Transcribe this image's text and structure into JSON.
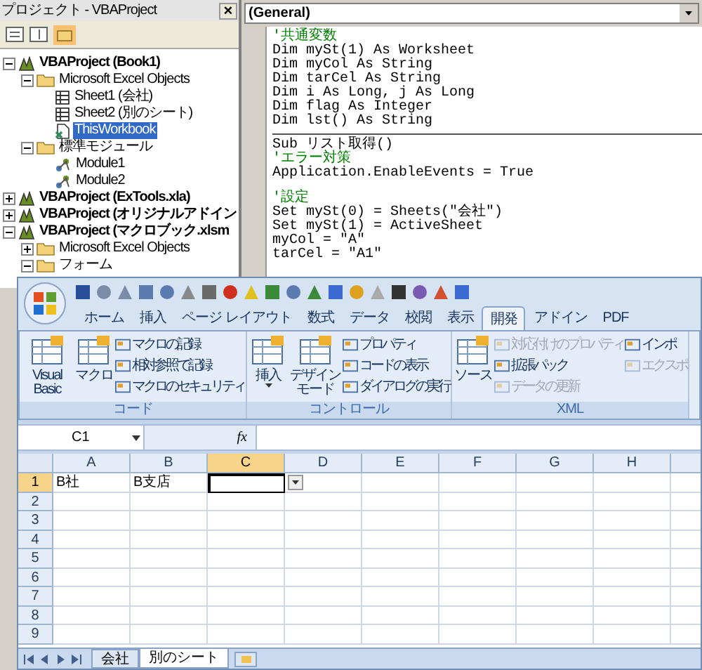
{
  "project_pane": {
    "title": "プロジェクト - VBAProject",
    "close": "×",
    "tree": [
      {
        "label": "VBAProject (Book1)",
        "kind": "project",
        "expanded": true,
        "selected": false,
        "children": [
          {
            "label": "Microsoft Excel Objects",
            "kind": "folder",
            "expanded": true,
            "selected": false,
            "children": [
              {
                "label": "Sheet1 (会社)",
                "kind": "sheet",
                "selected": false
              },
              {
                "label": "Sheet2 (別のシート)",
                "kind": "sheet",
                "selected": false
              },
              {
                "label": "ThisWorkbook",
                "kind": "workbook",
                "selected": true
              }
            ]
          },
          {
            "label": "標準モジュール",
            "kind": "folder",
            "expanded": true,
            "selected": false,
            "children": [
              {
                "label": "Module1",
                "kind": "module",
                "selected": false
              },
              {
                "label": "Module2",
                "kind": "module",
                "selected": false
              }
            ]
          }
        ]
      },
      {
        "label": "VBAProject (ExTools.xla)",
        "kind": "project",
        "expanded": false,
        "selected": false
      },
      {
        "label": "VBAProject (オリジナルアドイン",
        "kind": "project",
        "expanded": false,
        "selected": false
      },
      {
        "label": "VBAProject (マクロブック.xlsm",
        "kind": "project",
        "expanded": true,
        "selected": false,
        "children": [
          {
            "label": "Microsoft Excel Objects",
            "kind": "folder",
            "expanded": false,
            "selected": false
          },
          {
            "label": "フォーム",
            "kind": "folder",
            "expanded": true,
            "selected": false
          }
        ]
      }
    ]
  },
  "code_pane": {
    "object_dropdown": "(General)",
    "sections": [
      [
        {
          "kind": "comment",
          "text": "'共通変数"
        },
        {
          "kind": "code",
          "text": "Dim mySt(1) As Worksheet"
        },
        {
          "kind": "code",
          "text": "Dim myCol As String"
        },
        {
          "kind": "code",
          "text": "Dim tarCel As String"
        },
        {
          "kind": "code",
          "text": "Dim i As Long, j As Long"
        },
        {
          "kind": "code",
          "text": "Dim flag As Integer"
        },
        {
          "kind": "code",
          "text": "Dim lst() As String"
        }
      ],
      [
        {
          "kind": "code",
          "text": "Sub リスト取得()"
        },
        {
          "kind": "comment",
          "text": "'エラー対策"
        },
        {
          "kind": "code",
          "text": "Application.EnableEvents = True"
        },
        {
          "kind": "blank"
        },
        {
          "kind": "comment",
          "text": "'設定"
        },
        {
          "kind": "code",
          "text": "Set mySt(0) = Sheets(\"会社\")"
        },
        {
          "kind": "code",
          "text": "Set mySt(1) = ActiveSheet"
        },
        {
          "kind": "code",
          "text": "myCol = \"A\""
        },
        {
          "kind": "code",
          "text": "tarCel = \"A1\""
        }
      ]
    ]
  },
  "excel": {
    "tabs": [
      {
        "label": "ホーム",
        "selected": false
      },
      {
        "label": "挿入",
        "selected": false
      },
      {
        "label": "ページ レイアウト",
        "selected": false
      },
      {
        "label": "数式",
        "selected": false
      },
      {
        "label": "データ",
        "selected": false
      },
      {
        "label": "校閲",
        "selected": false
      },
      {
        "label": "表示",
        "selected": false
      },
      {
        "label": "開発",
        "selected": true
      },
      {
        "label": "アドイン",
        "selected": false
      },
      {
        "label": "PDF",
        "selected": false
      }
    ],
    "groups": [
      {
        "label": "コード",
        "items": [
          {
            "kind": "large",
            "label": "Visual Basic"
          },
          {
            "kind": "large",
            "label": "マクロ"
          },
          {
            "kind": "stack",
            "items": [
              {
                "label": "マクロの記録",
                "disabled": false
              },
              {
                "label": "相対参照で記録",
                "disabled": false
              },
              {
                "label": "マクロのセキュリティ",
                "disabled": false
              }
            ]
          }
        ]
      },
      {
        "label": "コントロール",
        "items": [
          {
            "kind": "large",
            "label": "挿入",
            "caret": true
          },
          {
            "kind": "large",
            "label": "デザインモード"
          },
          {
            "kind": "stack",
            "items": [
              {
                "label": "プロパティ",
                "disabled": false
              },
              {
                "label": "コードの表示",
                "disabled": false
              },
              {
                "label": "ダイアログの実行",
                "disabled": false
              }
            ]
          }
        ]
      },
      {
        "label": "XML",
        "items": [
          {
            "kind": "large",
            "label": "ソース"
          },
          {
            "kind": "stack",
            "items": [
              {
                "label": "対応付けのプロパティ",
                "disabled": true
              },
              {
                "label": "拡張パック",
                "disabled": false
              },
              {
                "label": "データの更新",
                "disabled": true
              }
            ]
          },
          {
            "kind": "stack",
            "items": [
              {
                "label": "インポ",
                "disabled": false
              },
              {
                "label": "エクスポ",
                "disabled": true
              }
            ]
          }
        ]
      }
    ],
    "name_box": "C1",
    "formula_label": "fx",
    "columns": [
      {
        "label": "A",
        "selected": false
      },
      {
        "label": "B",
        "selected": false
      },
      {
        "label": "C",
        "selected": true
      },
      {
        "label": "D",
        "selected": false
      },
      {
        "label": "E",
        "selected": false
      },
      {
        "label": "F",
        "selected": false
      },
      {
        "label": "G",
        "selected": false
      },
      {
        "label": "H",
        "selected": false
      }
    ],
    "rows": [
      {
        "label": "1",
        "selected": true,
        "cells": [
          "B社",
          "B支店"
        ]
      },
      {
        "label": "2",
        "selected": false
      },
      {
        "label": "3",
        "selected": false
      },
      {
        "label": "4",
        "selected": false
      },
      {
        "label": "5",
        "selected": false
      },
      {
        "label": "6",
        "selected": false
      },
      {
        "label": "7",
        "selected": false
      },
      {
        "label": "8",
        "selected": false
      },
      {
        "label": "9",
        "selected": false
      }
    ],
    "sheet_tabs": [
      {
        "label": "会社",
        "selected": false
      },
      {
        "label": "別のシート",
        "selected": true
      }
    ]
  }
}
